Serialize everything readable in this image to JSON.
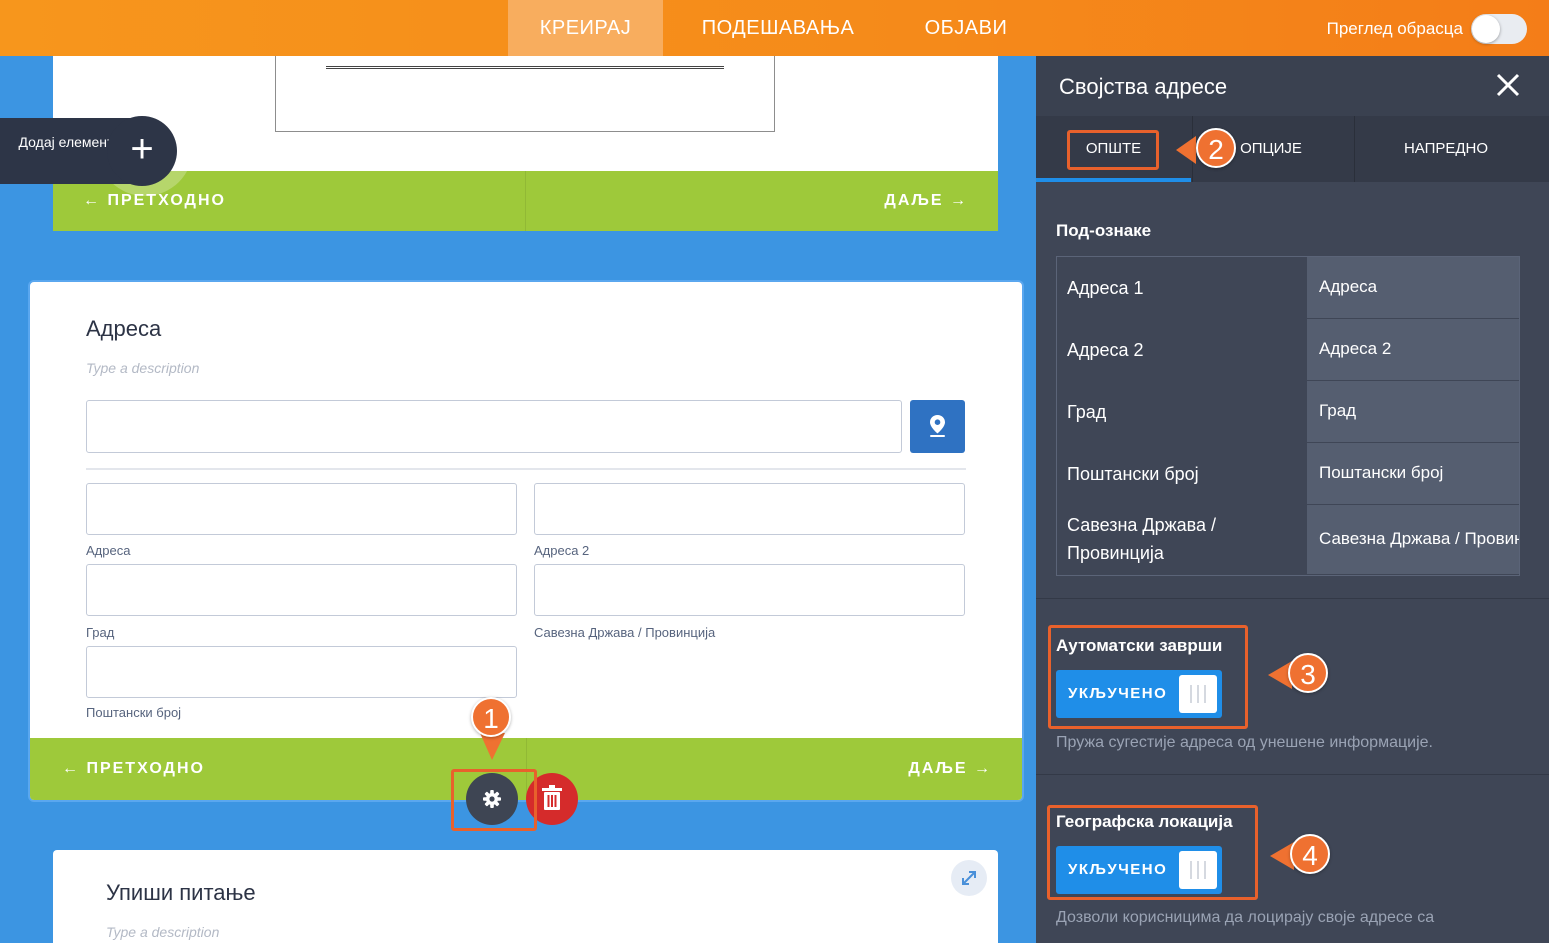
{
  "topbar": {
    "tabs": [
      {
        "label": "КРЕИРАЈ",
        "active": true
      },
      {
        "label": "ПОДЕШАВАЊА",
        "active": false
      },
      {
        "label": "ОБЈАВИ",
        "active": false
      }
    ],
    "preview_label": "Преглед обрасца",
    "preview_toggle_on": false
  },
  "add_element": {
    "label": "Додај елемент",
    "icon": "plus-icon"
  },
  "nav": {
    "prev": "← ПРЕТХОДНО",
    "next": "ДАЉЕ →"
  },
  "address_card": {
    "title": "Адреса",
    "description_placeholder": "Type a description",
    "sublabels": [
      "Адреса",
      "Адреса 2",
      "Град",
      "Савезна Држава / Провинција",
      "Поштански број"
    ],
    "location_icon": "map-pin-icon"
  },
  "question_card": {
    "title": "Упиши питање",
    "description_placeholder": "Type a description",
    "expand_icon": "expand-icon"
  },
  "panel": {
    "title": "Својства адресе",
    "tabs": [
      "ОПШТЕ",
      "ОПЦИЈЕ",
      "НАПРЕДНО"
    ],
    "sublabels_heading": "Под-ознаке",
    "sublabels": [
      {
        "name": "Адреса 1",
        "value": "Адреса"
      },
      {
        "name": "Адреса 2",
        "value": "Адреса 2"
      },
      {
        "name": "Град",
        "value": "Град"
      },
      {
        "name": "Поштански број",
        "value": "Поштански број"
      },
      {
        "name": "Савезна Држава / Провинција",
        "value": "Савезна Држава / Провинција"
      }
    ],
    "autocomplete": {
      "label": "Аутоматски заврши",
      "state": "УКЉУЧЕНО",
      "help": "Пружа сугестије адреса од унешене информације."
    },
    "geolocation": {
      "label": "Географска локација",
      "state": "УКЉУЧЕНО",
      "help": "Дозволи корисницима да лоцирају своје адресе са"
    }
  },
  "callouts": [
    "1",
    "2",
    "3",
    "4"
  ],
  "colors": {
    "accent": "#f7961c",
    "green": "#9ec93a",
    "blue": "#1f8ee8",
    "panel": "#3f4656",
    "callout": "#ef7131"
  }
}
